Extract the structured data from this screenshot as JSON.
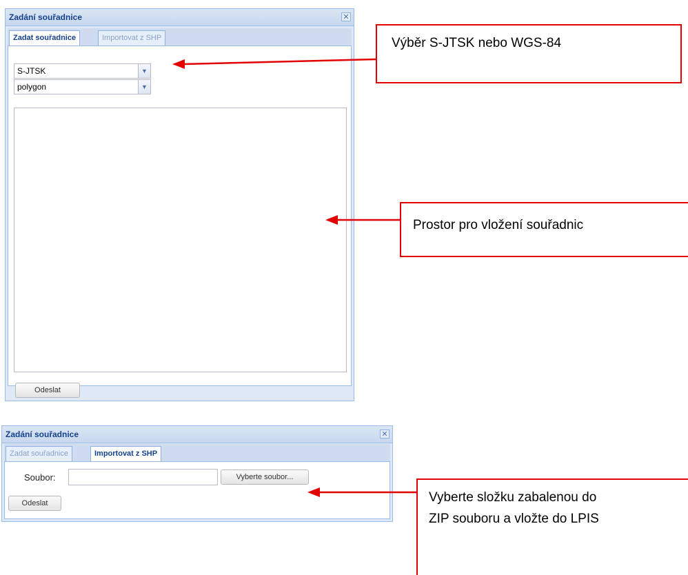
{
  "window1": {
    "title": "Zadání souřadnice",
    "tabs": [
      {
        "label": "Zadat souřadnice",
        "active": true
      },
      {
        "label": "Importovat z SHP",
        "active": false
      }
    ],
    "coord_system": {
      "value": "S-JTSK"
    },
    "geometry_type": {
      "value": "polygon"
    },
    "submit_label": "Odeslat"
  },
  "window2": {
    "title": "Zadání souřadnice",
    "tabs": [
      {
        "label": "Zadat souřadnice",
        "active": false
      },
      {
        "label": "Importovat z SHP",
        "active": true
      }
    ],
    "file_label": "Soubor:",
    "file_value": "",
    "browse_label": "Vyberte soubor...",
    "submit_label": "Odeslat"
  },
  "annotations": {
    "select_system": "Výběr S-JTSK nebo WGS-84",
    "coords_area": "Prostor pro vložení souřadnic",
    "zip_line1": "Vyberte složku zabalenou do",
    "zip_line2": "ZIP souboru a vložte do LPIS"
  },
  "colors": {
    "header_text": "#15428b",
    "window_border": "#99bbe8",
    "annotation_red": "#e30000"
  }
}
